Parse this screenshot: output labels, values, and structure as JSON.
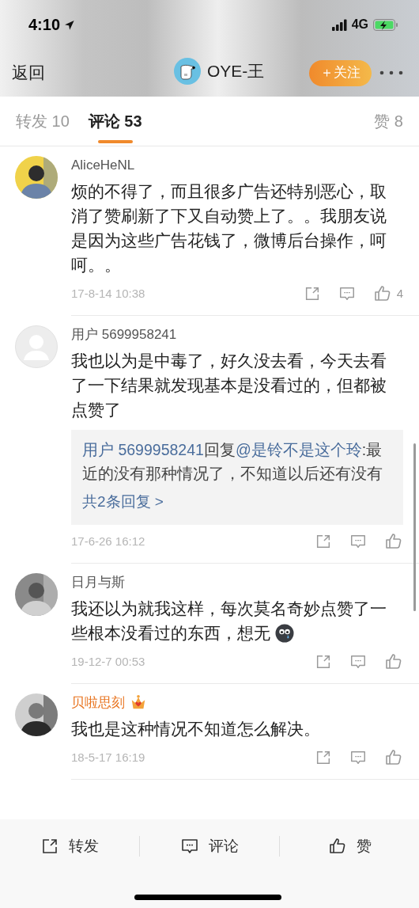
{
  "status_bar": {
    "time": "4:10",
    "network": "4G"
  },
  "nav": {
    "back": "返回",
    "title": "OYE-王",
    "follow": "＋关注"
  },
  "tabs": [
    {
      "label": "转发 10",
      "selected": false
    },
    {
      "label": "评论 53",
      "selected": true
    },
    {
      "label": "赞 8",
      "selected": false
    }
  ],
  "comments": [
    {
      "name": "AliceHeNL",
      "vip": false,
      "text": "烦的不得了，而且很多广告还特别恶心，取消了赞刷新了下又自动赞上了。。我朋友说是因为这些广告花钱了，微博后台操作，呵呵。。",
      "time": "17-8-14 10:38",
      "likes": "4"
    },
    {
      "avatar": {
        "kind": "silhouette"
      },
      "name": "用户 5699958241",
      "vip": false,
      "text": "我也以为是中毒了，好久没去看，今天去看了一下结果就发现基本是没看过的，但都被点赞了",
      "reply": {
        "author": "用户 5699958241",
        "verb": "回复",
        "mention": "@是铃不是这个玲",
        "text": ":最近的没有那种情况了，不知道以后还有没有",
        "more": "共2条回复 >"
      },
      "time": "17-6-26 16:12"
    },
    {
      "name": "日月与斯",
      "vip": false,
      "text": "我还以为就我这样，每次莫名奇妙点赞了一些根本没看过的东西，想无",
      "emoji": true,
      "time": "19-12-7 00:53"
    },
    {
      "name": "贝啦思刻",
      "vip": true,
      "text": "我也是这种情况不知道怎么解决。",
      "time": "18-5-17 16:19"
    }
  ],
  "toolbar": [
    "转发",
    "评论",
    "赞"
  ]
}
